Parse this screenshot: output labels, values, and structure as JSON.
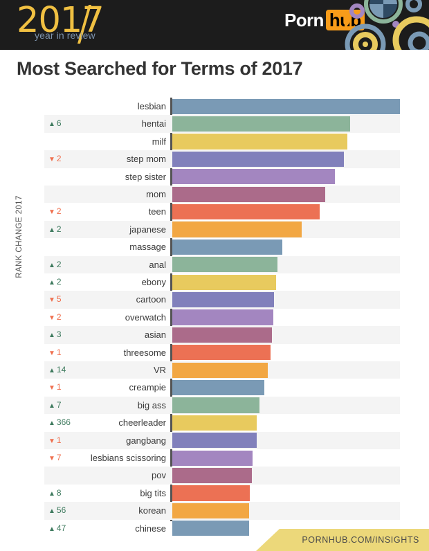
{
  "header": {
    "year": "2017",
    "year_sub": "year in review",
    "brand_first": "Porn",
    "brand_second": "hub",
    "bg_color": "#1c1c1c",
    "accent_gold": "#f0c042",
    "accent_orange": "#f89c19"
  },
  "title": "Most Searched for Terms of 2017",
  "axis_title": "RANK CHANGE 2017",
  "footer": {
    "url": "PORNHUB.COM/INSIGHTS",
    "band_color": "#ecd87a"
  },
  "chart_data": {
    "type": "bar",
    "orientation": "horizontal",
    "title": "Most Searched for Terms of 2017",
    "xlabel": "",
    "ylabel": "RANK CHANGE 2017",
    "grid": false,
    "legend": "none",
    "xlim": [
      0,
      100
    ],
    "axis_note": "Bar lengths are relative search volume index; longest bar (lesbian) = 100",
    "palette": [
      "#7a9ab5",
      "#8cb49a",
      "#e8ca5e",
      "#8180bb",
      "#a386c0",
      "#ab6b8a",
      "#ec7154",
      "#f2a743"
    ],
    "up_color": "#3e7a5e",
    "down_color": "#ef6f4e",
    "categories": [
      "lesbian",
      "hentai",
      "milf",
      "step mom",
      "step sister",
      "mom",
      "teen",
      "japanese",
      "massage",
      "anal",
      "ebony",
      "cartoon",
      "overwatch",
      "asian",
      "threesome",
      "VR",
      "creampie",
      "big ass",
      "cheerleader",
      "gangbang",
      "lesbians scissoring",
      "pov",
      "big tits",
      "korean",
      "chinese"
    ],
    "values": [
      100.0,
      78.1,
      76.9,
      75.4,
      71.4,
      67.2,
      64.7,
      56.8,
      48.3,
      46.2,
      45.6,
      44.7,
      44.4,
      43.8,
      43.2,
      42.0,
      40.4,
      38.3,
      37.1,
      37.1,
      35.3,
      35.0,
      34.1,
      33.7,
      33.7
    ],
    "rank_changes": [
      null,
      {
        "dir": "up",
        "value": 6
      },
      null,
      {
        "dir": "down",
        "value": 2
      },
      null,
      null,
      {
        "dir": "down",
        "value": 2
      },
      {
        "dir": "up",
        "value": 2
      },
      null,
      {
        "dir": "up",
        "value": 2
      },
      {
        "dir": "up",
        "value": 2
      },
      {
        "dir": "down",
        "value": 5
      },
      {
        "dir": "down",
        "value": 2
      },
      {
        "dir": "up",
        "value": 3
      },
      {
        "dir": "down",
        "value": 1
      },
      {
        "dir": "up",
        "value": 14
      },
      {
        "dir": "down",
        "value": 1
      },
      {
        "dir": "up",
        "value": 7
      },
      {
        "dir": "up",
        "value": 366
      },
      {
        "dir": "down",
        "value": 1
      },
      {
        "dir": "down",
        "value": 7
      },
      null,
      {
        "dir": "up",
        "value": 8
      },
      {
        "dir": "up",
        "value": 56
      },
      {
        "dir": "up",
        "value": 47
      }
    ]
  }
}
